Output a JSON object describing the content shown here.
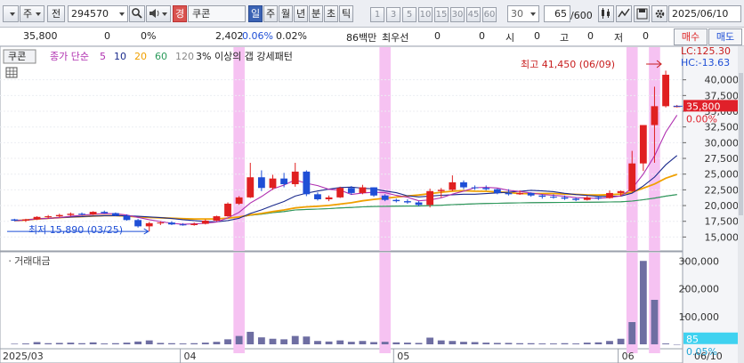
{
  "toolbar": {
    "market": "주",
    "type_btn": "전",
    "code": "294570",
    "grade": "경",
    "name": "쿠콘",
    "periods": [
      "일",
      "주",
      "월",
      "년",
      "분",
      "초",
      "틱"
    ],
    "active_period": "일",
    "minutes": [
      "1",
      "3",
      "5",
      "10",
      "15",
      "30",
      "45",
      "60"
    ],
    "interval": "30",
    "count": "65",
    "max_count": "/600",
    "date": "2025/06/10"
  },
  "quote": {
    "price": "35,800",
    "change": "0",
    "change_pct": "0%",
    "volume": "2,402",
    "turnover_pct": "0.06%",
    "ratio_pct": "0.02%",
    "amount": "86백만",
    "best_label": "최우선",
    "best_bid": "0",
    "best_ask": "0",
    "open_label": "시",
    "open": "0",
    "high_label": "고",
    "high": "0",
    "low_label": "저",
    "low": "0",
    "buy": "매수",
    "sell": "매도"
  },
  "legend": {
    "name": "쿠콘",
    "indicator": "종가 단순",
    "ma": [
      "5",
      "10",
      "20",
      "60",
      "120"
    ],
    "pattern": "3% 이상의 갭 강세패턴"
  },
  "colors": {
    "up": "#e02020",
    "down": "#1f4fd6",
    "ma5": "#b030b0",
    "ma10": "#1a2a8c",
    "ma20": "#f0a000",
    "ma60": "#2a9a5a",
    "ma120": "#8a8a8a",
    "highlight": "#f6c2f2",
    "vol": "#6e6ea2"
  },
  "annotations": {
    "high": "최고 41,450 (06/09)",
    "low": "최저 15,890 (03/25)",
    "lc": "LC:125.30",
    "hc": "HC:-13.63",
    "last": "35,800",
    "last_pct": "0.00%",
    "vol_last": "85",
    "vol_pct": "0.05%"
  },
  "volume_title": "거래대금",
  "chart_data": {
    "type": "candlestick",
    "price_axis": {
      "min": 13500,
      "max": 42500,
      "ticks": [
        15000,
        17500,
        20000,
        22500,
        25000,
        27500,
        30000,
        32500,
        35000,
        37500,
        40000
      ]
    },
    "volume_axis": {
      "min": 0,
      "max": 320000,
      "ticks": [
        100000,
        200000,
        300000
      ]
    },
    "x_labels": [
      {
        "label": "2025/03",
        "i": 0
      },
      {
        "label": "04",
        "i": 15
      },
      {
        "label": "05",
        "i": 34
      },
      {
        "label": "06",
        "i": 54
      },
      {
        "label": "06/10",
        "i": 59
      }
    ],
    "highlights": [
      20,
      33,
      55,
      57
    ],
    "candles": [
      [
        17800,
        17900,
        17500,
        17600
      ],
      [
        17600,
        17900,
        17400,
        17800
      ],
      [
        17800,
        18300,
        17700,
        18200
      ],
      [
        18200,
        18500,
        17900,
        18300
      ],
      [
        18300,
        18700,
        18100,
        18500
      ],
      [
        18500,
        18900,
        18300,
        18700
      ],
      [
        18700,
        18900,
        18400,
        18600
      ],
      [
        18600,
        19100,
        18500,
        19000
      ],
      [
        19000,
        19200,
        18700,
        18800
      ],
      [
        18800,
        18900,
        18300,
        18400
      ],
      [
        18400,
        18600,
        17600,
        17700
      ],
      [
        17700,
        17900,
        16500,
        16700
      ],
      [
        16700,
        17400,
        15890,
        17200
      ],
      [
        17200,
        17500,
        16900,
        17300
      ],
      [
        17300,
        17500,
        16900,
        17000
      ],
      [
        17000,
        17200,
        16800,
        16900
      ],
      [
        16900,
        17300,
        16800,
        17100
      ],
      [
        17100,
        17800,
        17000,
        17600
      ],
      [
        17600,
        18400,
        17500,
        18300
      ],
      [
        18300,
        20500,
        18200,
        20300
      ],
      [
        20300,
        21500,
        20100,
        21300
      ],
      [
        21300,
        26800,
        21200,
        24500
      ],
      [
        24500,
        25600,
        22300,
        22800
      ],
      [
        22800,
        24900,
        22500,
        24300
      ],
      [
        24300,
        25200,
        22900,
        23400
      ],
      [
        23400,
        26800,
        23000,
        25400
      ],
      [
        25400,
        25600,
        21500,
        21800
      ],
      [
        21800,
        22100,
        20800,
        21000
      ],
      [
        21000,
        21600,
        20700,
        21300
      ],
      [
        21300,
        23000,
        21200,
        22800
      ],
      [
        22800,
        23100,
        21700,
        22000
      ],
      [
        22000,
        23300,
        21800,
        22900
      ],
      [
        22900,
        22900,
        21400,
        21600
      ],
      [
        21600,
        21800,
        20700,
        20900
      ],
      [
        20900,
        21100,
        20500,
        20700
      ],
      [
        20700,
        21000,
        20300,
        20500
      ],
      [
        20500,
        20700,
        19900,
        20100
      ],
      [
        20100,
        22700,
        19700,
        22300
      ],
      [
        22300,
        22800,
        21300,
        22500
      ],
      [
        22500,
        24800,
        22300,
        23700
      ],
      [
        23700,
        24000,
        22600,
        22900
      ],
      [
        22900,
        23200,
        22500,
        22800
      ],
      [
        22800,
        23200,
        22400,
        22600
      ],
      [
        22600,
        22700,
        21800,
        22000
      ],
      [
        22000,
        22600,
        21600,
        21800
      ],
      [
        21800,
        22400,
        21700,
        22000
      ],
      [
        22000,
        22100,
        21400,
        21600
      ],
      [
        21600,
        21800,
        21100,
        21400
      ],
      [
        21400,
        21800,
        21100,
        21300
      ],
      [
        21300,
        21600,
        20900,
        21100
      ],
      [
        21100,
        21300,
        20700,
        20900
      ],
      [
        20900,
        21500,
        20800,
        21300
      ],
      [
        21300,
        21500,
        20900,
        21200
      ],
      [
        21200,
        22400,
        21100,
        22000
      ],
      [
        22000,
        22400,
        21500,
        22300
      ],
      [
        22300,
        28700,
        22200,
        26700
      ],
      [
        26700,
        30000,
        25500,
        32800
      ],
      [
        32800,
        38900,
        26800,
        35800
      ],
      [
        35800,
        41450,
        35600,
        40800
      ],
      [
        35800,
        36000,
        35600,
        35800
      ]
    ],
    "volume": [
      2000,
      3000,
      8000,
      4000,
      5000,
      6000,
      4000,
      7000,
      3000,
      4000,
      6000,
      10000,
      14000,
      5000,
      4000,
      3000,
      4000,
      6000,
      9000,
      18000,
      30000,
      45000,
      25000,
      20000,
      18000,
      30000,
      28000,
      12000,
      10000,
      14000,
      9000,
      12000,
      8000,
      9000,
      7000,
      6000,
      5000,
      24000,
      14000,
      12000,
      9000,
      8000,
      6000,
      5000,
      5000,
      4000,
      4000,
      3000,
      3000,
      4000,
      3000,
      6000,
      7000,
      12000,
      20000,
      80000,
      300000,
      160000,
      3000,
      85
    ]
  }
}
